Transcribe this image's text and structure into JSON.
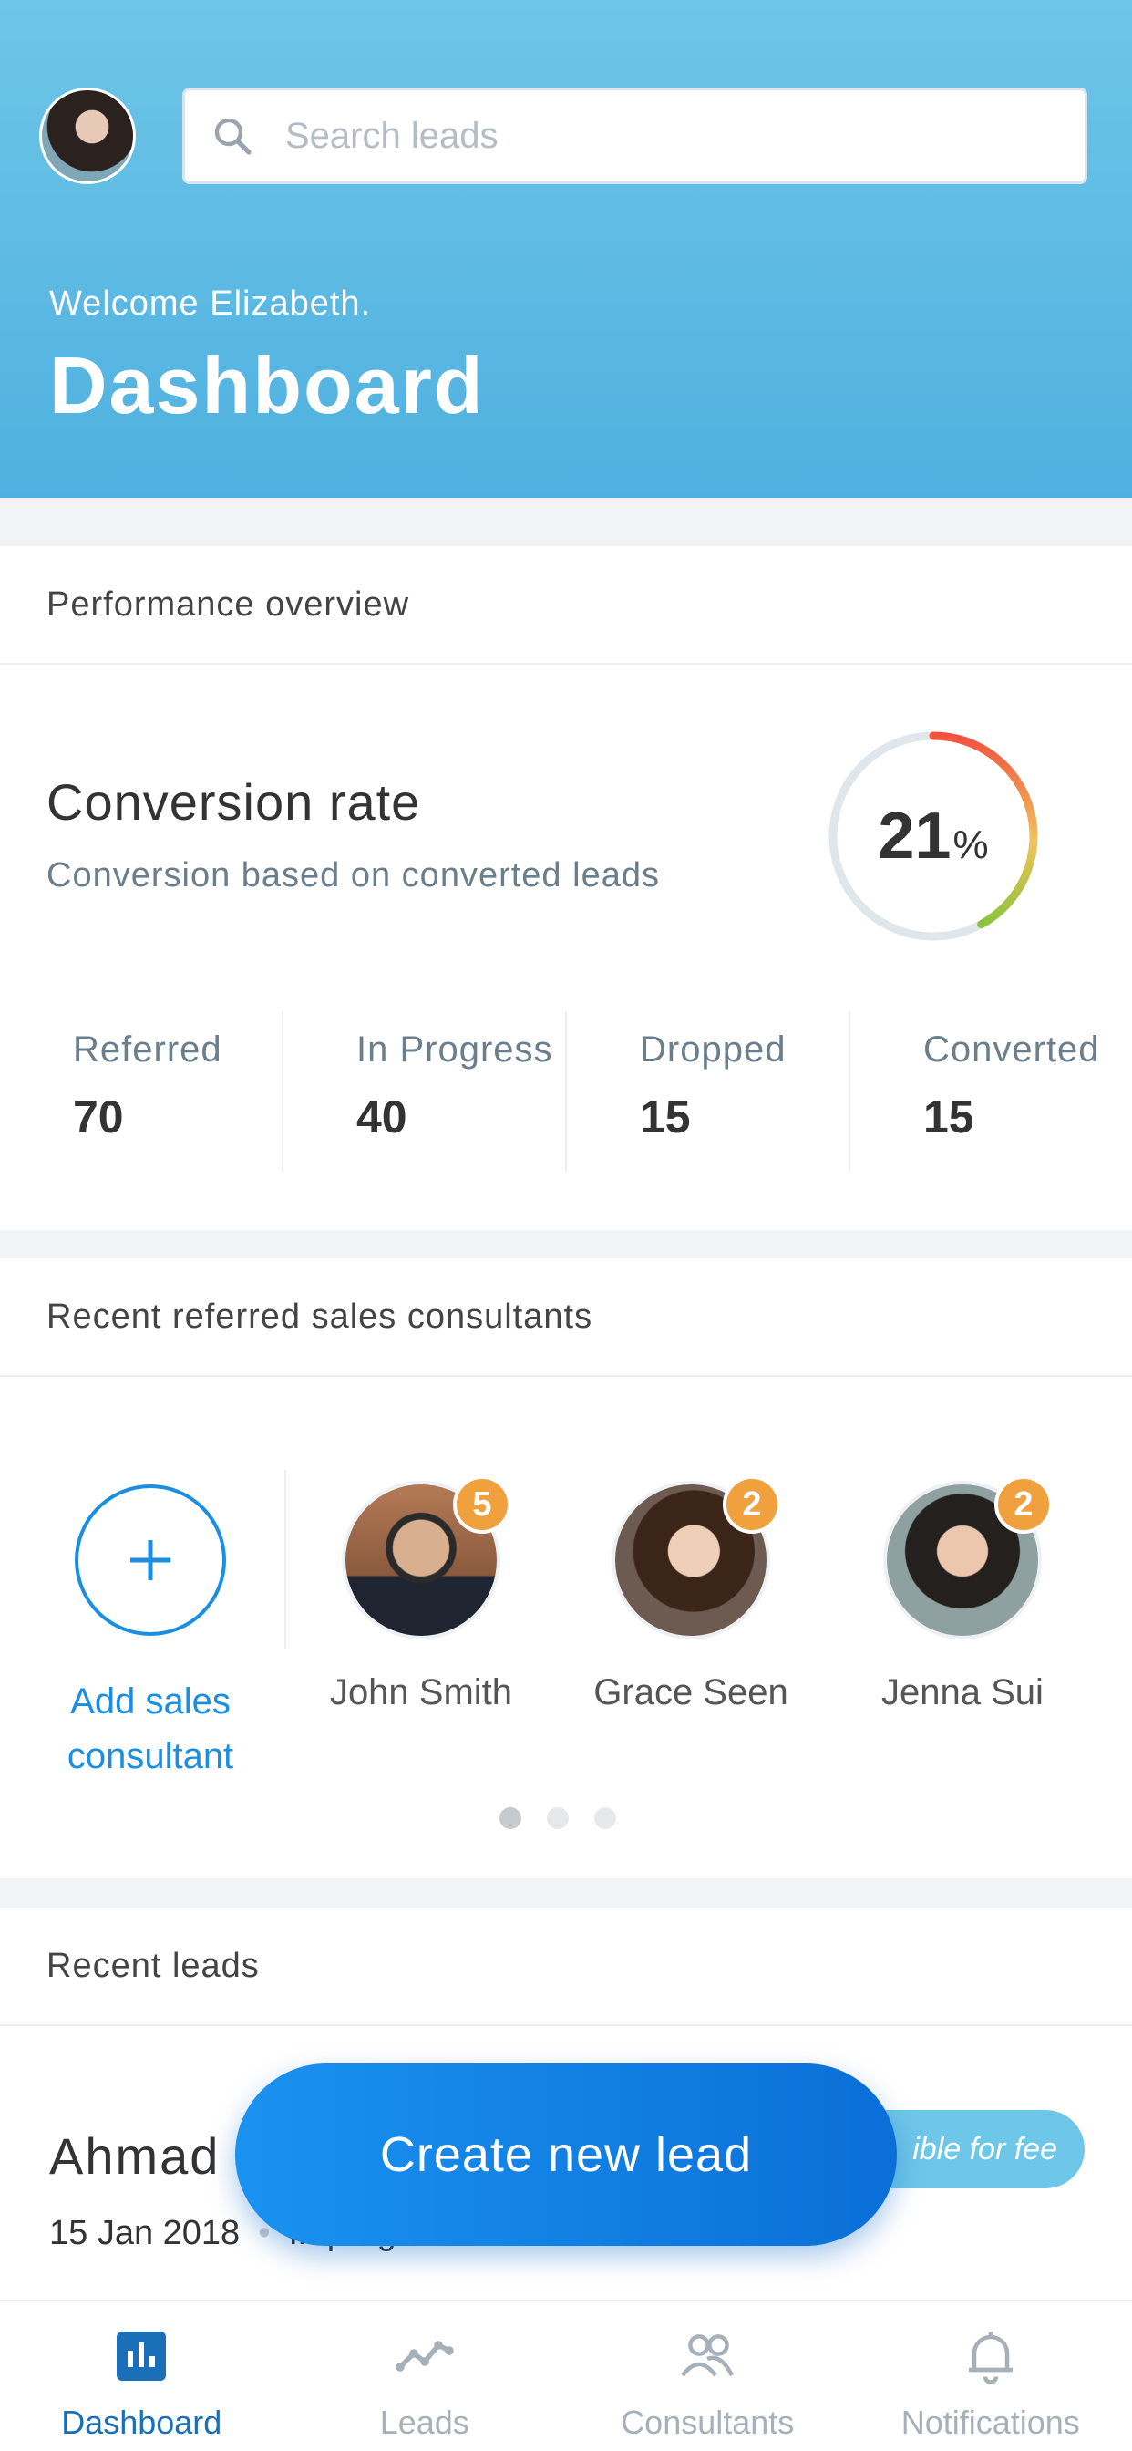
{
  "header": {
    "search_placeholder": "Search leads",
    "welcome": "Welcome Elizabeth.",
    "title": "Dashboard"
  },
  "performance": {
    "section_title": "Performance overview",
    "conversion_title": "Conversion rate",
    "conversion_subtitle": "Conversion based on converted leads",
    "conversion_value": "21",
    "conversion_unit": "%",
    "conversion_fraction": 0.21,
    "stats": [
      {
        "label": "Referred",
        "value": "70"
      },
      {
        "label": "In Progress",
        "value": "40"
      },
      {
        "label": "Dropped",
        "value": "15"
      },
      {
        "label": "Converted",
        "value": "15"
      }
    ]
  },
  "consultants": {
    "section_title": "Recent referred sales consultants",
    "add_label": "Add sales consultant",
    "people": [
      {
        "name": "John Smith",
        "badge": "5"
      },
      {
        "name": "Grace Seen",
        "badge": "2"
      },
      {
        "name": "Jenna Sui",
        "badge": "2"
      }
    ],
    "page_index": 1,
    "page_count": 3
  },
  "leads": {
    "section_title": "Recent leads",
    "items": [
      {
        "name": "Ahmad",
        "date": "15 Jan 2018",
        "status": "In progress",
        "badge": "ible for fee"
      }
    ]
  },
  "fab_label": "Create new lead",
  "nav": [
    {
      "label": "Dashboard",
      "icon": "dashboard-icon",
      "active": true
    },
    {
      "label": "Leads",
      "icon": "leads-trend-icon",
      "active": false
    },
    {
      "label": "Consultants",
      "icon": "consultants-icon",
      "active": false
    },
    {
      "label": "Notifications",
      "icon": "bell-icon",
      "active": false
    }
  ],
  "colors": {
    "header": "#5bb9e3",
    "accent": "#1a8ee0",
    "badge": "#f0a03c",
    "lead_badge": "#6ec6e8"
  }
}
